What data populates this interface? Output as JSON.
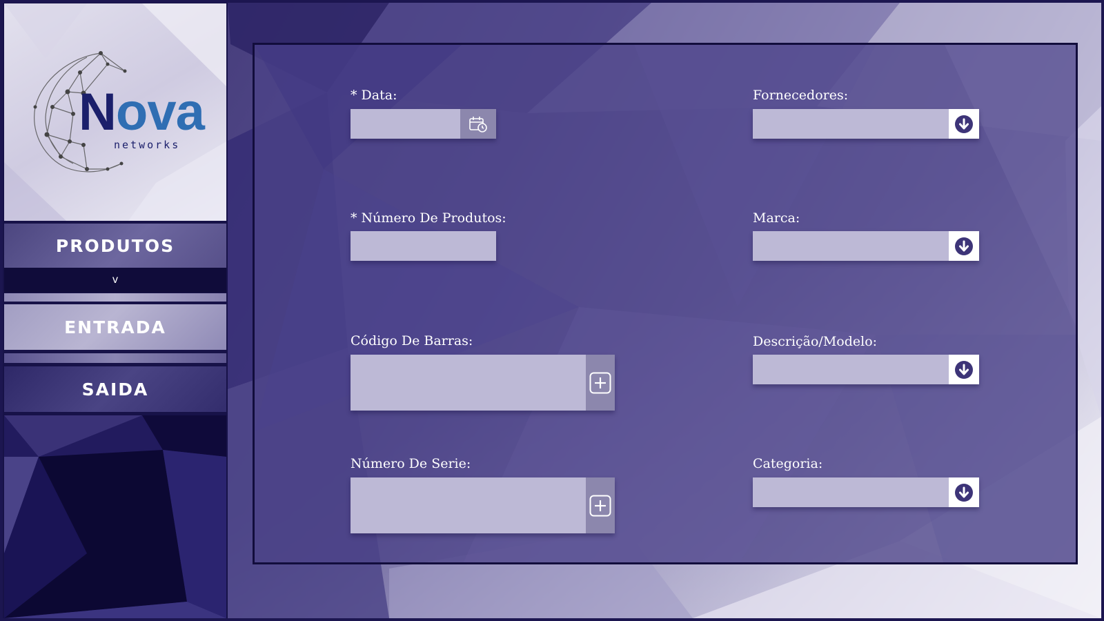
{
  "brand": {
    "logo_main_initial": "N",
    "logo_main_rest": "ova",
    "logo_sub": "networks",
    "colors": {
      "primary": "#1b1f6b",
      "secondary": "#2f6eb3"
    }
  },
  "sidebar": {
    "items": [
      {
        "label": "PRODUTOS"
      },
      {
        "label": "ENTRADA"
      },
      {
        "label": "SAIDA"
      }
    ],
    "chevron": "v"
  },
  "form": {
    "data": {
      "label": "* Data:",
      "value": "",
      "icon": "calendar-clock-icon"
    },
    "numero_produtos": {
      "label": " * Número De Produtos:",
      "value": ""
    },
    "codigo_barras": {
      "label": "Código De Barras:",
      "value": "",
      "icon": "plus-icon"
    },
    "numero_serie": {
      "label": "Número De Serie:",
      "value": "",
      "icon": "plus-icon"
    },
    "fornecedores": {
      "label": "Fornecedores:",
      "value": "",
      "icon": "arrow-down-circle-icon"
    },
    "marca": {
      "label": "Marca:",
      "value": "",
      "icon": "arrow-down-circle-icon"
    },
    "descricao_modelo": {
      "label": " Descrição/Modelo:",
      "value": "",
      "icon": "arrow-down-circle-icon"
    },
    "categoria": {
      "label": "Categoria:",
      "value": "",
      "icon": "arrow-down-circle-icon"
    }
  },
  "colors": {
    "frame": "#1c1650",
    "panel": "#4c4288",
    "field": "#bdb9d6",
    "dropdown_icon": "#3d3478"
  }
}
